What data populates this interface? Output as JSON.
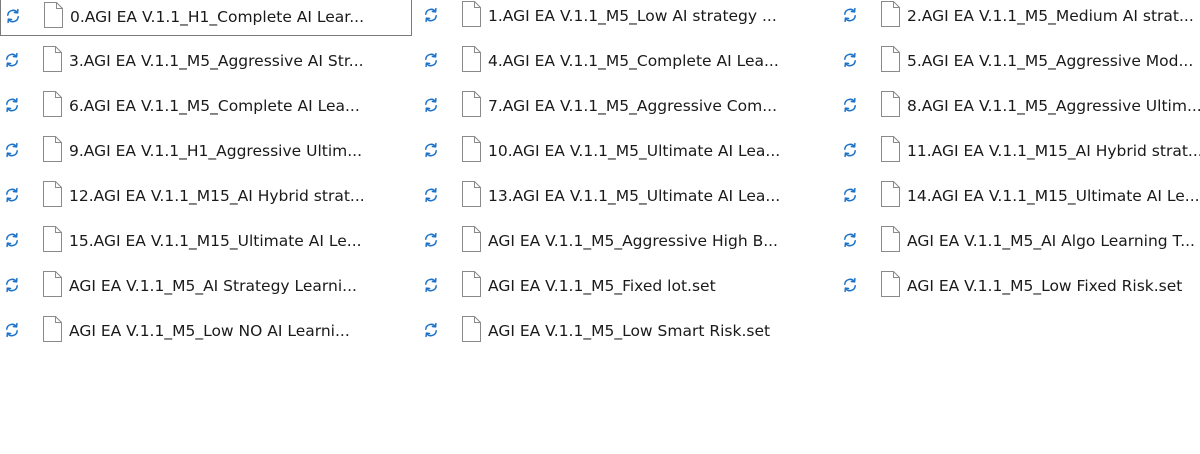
{
  "files": [
    {
      "name": "0.AGI EA V.1.1_H1_Complete AI Lear...",
      "status_icon": "sync-icon",
      "type_icon": "document-icon",
      "selected": true
    },
    {
      "name": "1.AGI EA V.1.1_M5_Low AI strategy ...",
      "status_icon": "sync-icon",
      "type_icon": "document-icon"
    },
    {
      "name": "2.AGI EA V.1.1_M5_Medium AI strat...",
      "status_icon": "sync-icon",
      "type_icon": "document-icon"
    },
    {
      "name": "3.AGI EA V.1.1_M5_Aggressive AI Str...",
      "status_icon": "sync-icon",
      "type_icon": "document-icon"
    },
    {
      "name": "4.AGI EA V.1.1_M5_Complete AI Lea...",
      "status_icon": "sync-icon",
      "type_icon": "document-icon"
    },
    {
      "name": "5.AGI EA V.1.1_M5_Aggressive Mod...",
      "status_icon": "sync-icon",
      "type_icon": "document-icon"
    },
    {
      "name": "6.AGI EA V.1.1_M5_Complete AI Lea...",
      "status_icon": "sync-icon",
      "type_icon": "document-icon"
    },
    {
      "name": "7.AGI EA V.1.1_M5_Aggressive Com...",
      "status_icon": "sync-icon",
      "type_icon": "document-icon"
    },
    {
      "name": "8.AGI EA V.1.1_M5_Aggressive Ultim...",
      "status_icon": "sync-icon",
      "type_icon": "document-icon"
    },
    {
      "name": "9.AGI EA V.1.1_H1_Aggressive Ultim...",
      "status_icon": "sync-icon",
      "type_icon": "document-icon"
    },
    {
      "name": "10.AGI EA V.1.1_M5_Ultimate AI Lea...",
      "status_icon": "sync-icon",
      "type_icon": "document-icon"
    },
    {
      "name": "11.AGI EA V.1.1_M15_AI Hybrid strat...",
      "status_icon": "sync-icon",
      "type_icon": "document-icon"
    },
    {
      "name": "12.AGI EA V.1.1_M15_AI Hybrid strat...",
      "status_icon": "sync-icon",
      "type_icon": "document-icon"
    },
    {
      "name": "13.AGI EA V.1.1_M5_Ultimate AI Lea...",
      "status_icon": "sync-icon",
      "type_icon": "document-icon"
    },
    {
      "name": "14.AGI EA V.1.1_M15_Ultimate AI Le...",
      "status_icon": "sync-icon",
      "type_icon": "document-icon"
    },
    {
      "name": "15.AGI EA V.1.1_M15_Ultimate AI Le...",
      "status_icon": "sync-icon",
      "type_icon": "document-icon"
    },
    {
      "name": "AGI EA V.1.1_M5_Aggressive High B...",
      "status_icon": "sync-icon",
      "type_icon": "document-icon"
    },
    {
      "name": "AGI EA V.1.1_M5_AI Algo Learning T...",
      "status_icon": "sync-icon",
      "type_icon": "document-icon"
    },
    {
      "name": "AGI EA V.1.1_M5_AI Strategy Learni...",
      "status_icon": "sync-icon",
      "type_icon": "document-icon"
    },
    {
      "name": "AGI EA V.1.1_M5_Fixed lot.set",
      "status_icon": "sync-icon",
      "type_icon": "document-icon"
    },
    {
      "name": "AGI EA V.1.1_M5_Low Fixed Risk.set",
      "status_icon": "sync-icon",
      "type_icon": "document-icon"
    },
    {
      "name": "AGI EA V.1.1_M5_Low NO AI Learni...",
      "status_icon": "sync-icon",
      "type_icon": "document-icon"
    },
    {
      "name": "AGI EA V.1.1_M5_Low Smart Risk.set",
      "status_icon": "sync-icon",
      "type_icon": "document-icon"
    }
  ],
  "colors": {
    "sync_icon": "#1e73c8",
    "doc_icon_stroke": "#8a8a8a",
    "text": "#1a1a1a",
    "selection_border": "#7a7a7a"
  }
}
